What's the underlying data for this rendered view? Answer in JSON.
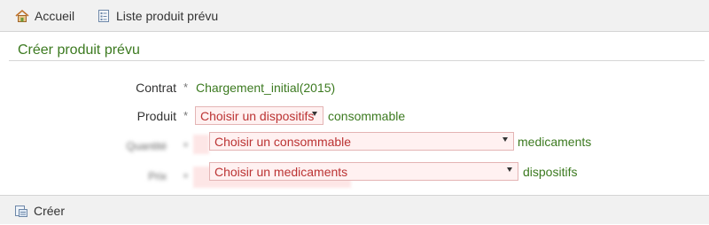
{
  "nav": {
    "home_label": "Accueil",
    "list_label": "Liste produit prévu"
  },
  "panel": {
    "title": "Créer produit prévu"
  },
  "form": {
    "required_mark": "*",
    "contrat": {
      "label": "Contrat",
      "value": "Chargement_initial(2015)"
    },
    "produit": {
      "label": "Produit",
      "select_value": "Choisir un dispositifs",
      "type_label": "consommable"
    },
    "quantite": {
      "label": "Quantité",
      "select_value": "Choisir un consommable",
      "type_label": "medicaments"
    },
    "prix": {
      "label": "Prix",
      "select_value": "Choisir un medicaments",
      "type_label": "dispositifs"
    }
  },
  "footer": {
    "create_label": "Créer"
  },
  "colors": {
    "accent_green": "#3c7a20",
    "invalid_red": "#b33",
    "invalid_bg": "#fff1f1",
    "bar_bg": "#f1f1f1"
  },
  "icons": {
    "home": "home-icon",
    "list": "list-icon",
    "create": "create-icon"
  }
}
